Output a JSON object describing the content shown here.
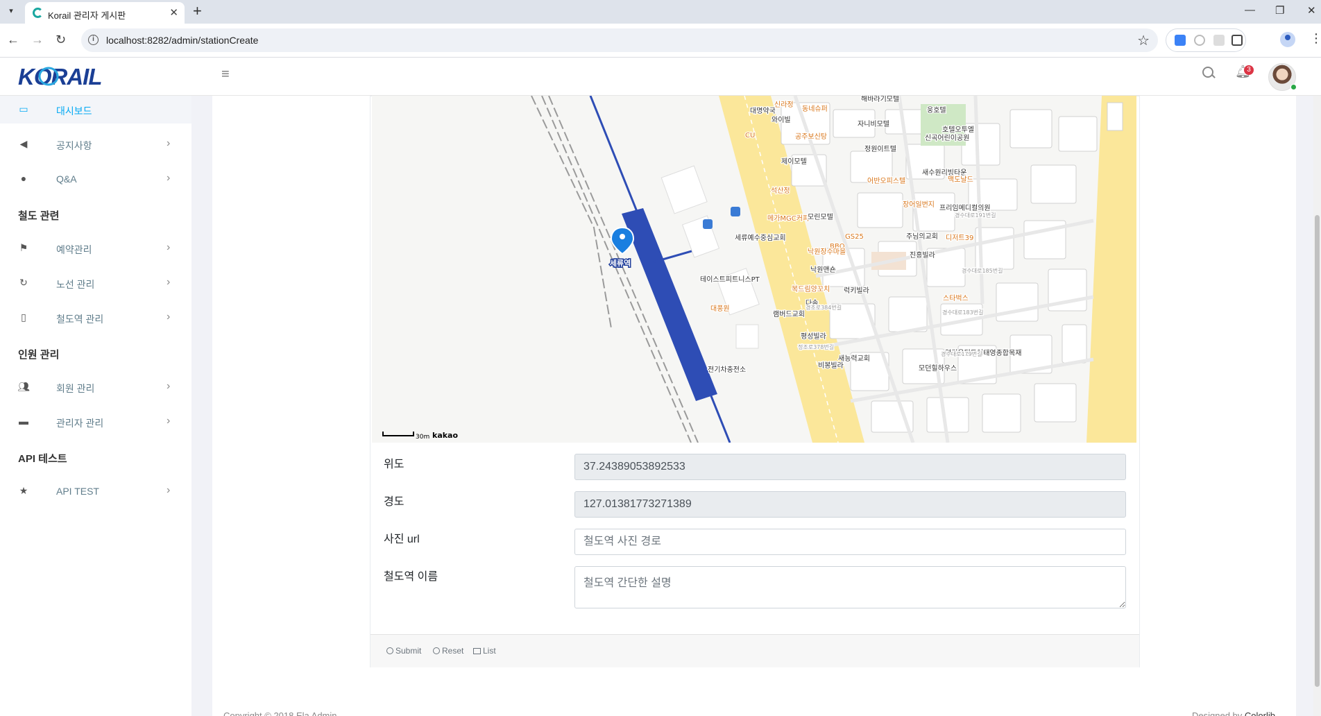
{
  "browser": {
    "tab_title": "Korail 관리자 게시판",
    "url": "localhost:8282/admin/stationCreate"
  },
  "header": {
    "logo_text": "KORAIL",
    "notification_count": "3"
  },
  "sidebar": {
    "items": [
      {
        "label": "대시보드",
        "icon": "laptop-icon"
      },
      {
        "label": "공지사항",
        "icon": "bullhorn-icon"
      },
      {
        "label": "Q&A",
        "icon": "comments-icon"
      },
      {
        "label": "예약관리",
        "icon": "flag-icon"
      },
      {
        "label": "노선 관리",
        "icon": "refresh-icon"
      },
      {
        "label": "철도역 관리",
        "icon": "building-icon"
      },
      {
        "label": "회원 관리",
        "icon": "users-icon"
      },
      {
        "label": "관리자 관리",
        "icon": "briefcase-icon"
      },
      {
        "label": "API TEST",
        "icon": "star-icon"
      }
    ],
    "sections": [
      "철도 관련",
      "인원 관리",
      "API 테스트"
    ]
  },
  "map": {
    "scale_label": "30m",
    "brand": "kakao",
    "marker_label": "세류역",
    "places": [
      "대명약국",
      "신라정",
      "동네슈퍼",
      "해바라기모텔",
      "와이빌",
      "자니비모텔",
      "웅호텔",
      "호텔오투엘",
      "CU",
      "공주보신탕",
      "정원이트텔",
      "제이모텔",
      "신곡어린이공원",
      "어반오피스텔",
      "새수원리빙타운",
      "맥도날드",
      "석산정",
      "장어일번지",
      "프리임메디컬의원",
      "메가MGC커피",
      "모린모텔",
      "세류예수중심교회",
      "GS25",
      "BBQ",
      "주님의교회",
      "디저트39",
      "낙원장수마을",
      "진흥빌라",
      "낙원맨숀",
      "테이스트피트니스PT",
      "복드림양꼬치",
      "럭키빌라",
      "다솜",
      "스타벅스",
      "대풍원",
      "램버드교회",
      "평성빌라",
      "새능력교회",
      "비봉빌라",
      "모던힐하우스",
      "영림올딩도어태영종합목재",
      "전기차충전소",
      "경수대로191번길",
      "경수대로185번길",
      "경수대로183번길",
      "경수대로179번길",
      "경조로384번길",
      "정조로378번길"
    ]
  },
  "form": {
    "latitude_label": "위도",
    "latitude_value": "37.24389053892533",
    "longitude_label": "경도",
    "longitude_value": "127.01381773271389",
    "photo_label": "사진 url",
    "photo_placeholder": "철도역 사진 경로",
    "name_label": "철도역 이름",
    "name_placeholder": "철도역 간단한 설명"
  },
  "footer_buttons": {
    "submit": "Submit",
    "reset": "Reset",
    "list": "List"
  },
  "page_footer": {
    "copyright": "Copyright © 2018 Ela Admin",
    "designed_by": "Designed by ",
    "designer": "Colorlib"
  },
  "colors": {
    "accent": "#03a9f3",
    "station_platform": "#2e4db5",
    "road_yellow": "#fbe79a"
  }
}
